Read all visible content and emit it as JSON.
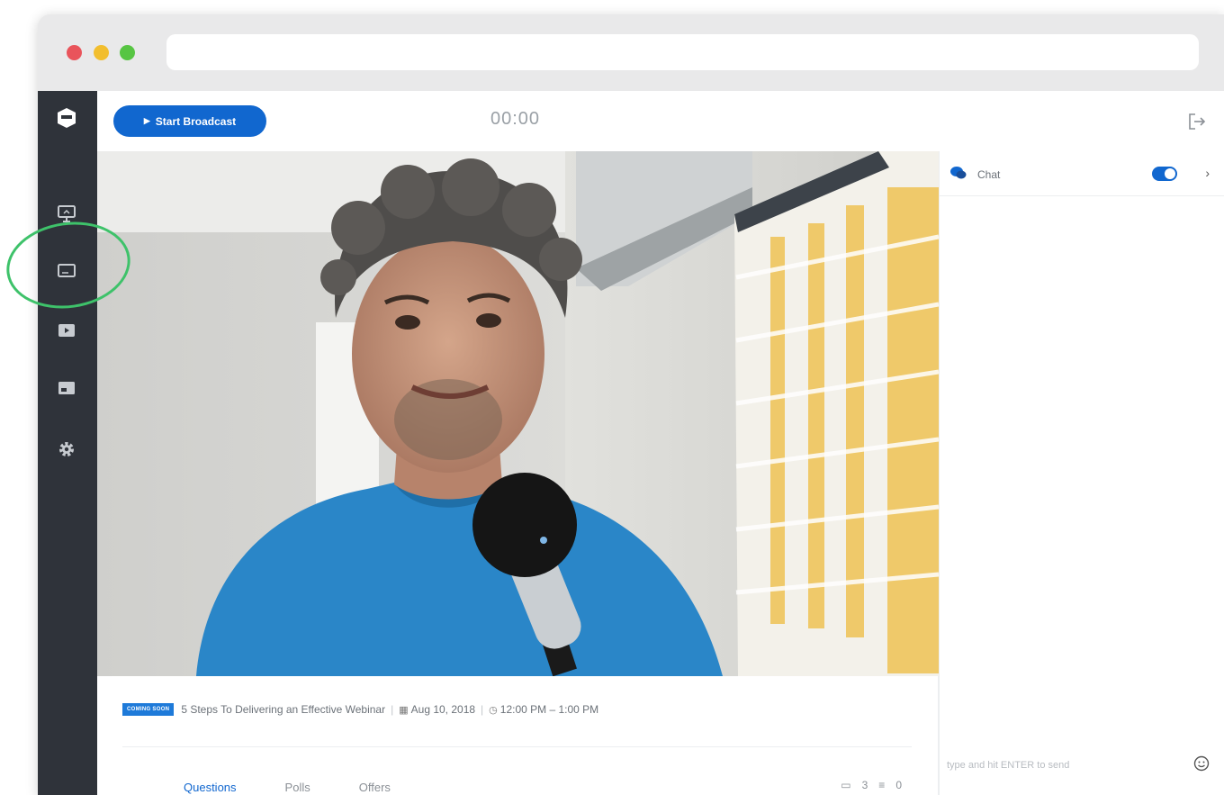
{
  "app": {
    "start_broadcast_label": "Start Broadcast",
    "timer": "00:00"
  },
  "sidebar": {
    "icons": [
      "logo-icon",
      "presentation-icon",
      "monitor-icon",
      "video-icon",
      "layout-icon",
      "gear-icon"
    ]
  },
  "webinar": {
    "badge": "COMING SOON",
    "title": "5 Steps To Delivering an Effective Webinar",
    "date": "Aug 10, 2018",
    "time": "12:00 PM – 1:00 PM"
  },
  "tabs": [
    {
      "label": "Questions",
      "active": true
    },
    {
      "label": "Polls",
      "active": false
    },
    {
      "label": "Offers",
      "active": false
    }
  ],
  "counters": {
    "questions": "3",
    "polls": "0"
  },
  "chat": {
    "title": "Chat",
    "enabled": true,
    "input_placeholder": "type and hit ENTER to send"
  },
  "colors": {
    "accent": "#1167cf",
    "sidebar": "#2f333a",
    "highlight": "#3ec26a"
  }
}
